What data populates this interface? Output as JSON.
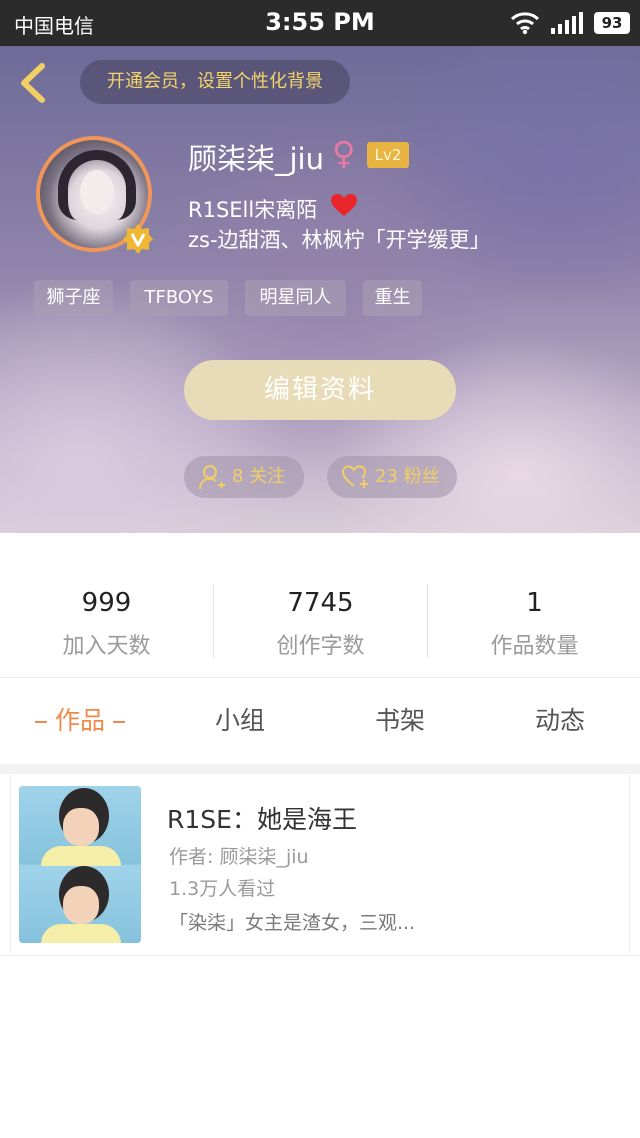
{
  "statusbar": {
    "carrier": "中国电信",
    "time": "3:55 PM",
    "battery": "93"
  },
  "header": {
    "vip_prompt": "开通会员，设置个性化背景",
    "username": "顾柒柒_jiu",
    "gender_symbol": "♀",
    "level": "Lv2",
    "bio_line1": "R1SEll宋离陌",
    "bio_line2": "zs-边甜酒、林枫柠「开学缓更」",
    "tags": [
      "狮子座",
      "TFBOYS",
      "明星同人",
      "重生"
    ],
    "edit_label": "编辑资料",
    "following_label": "8 关注",
    "followers_label": "23 粉丝"
  },
  "stats": [
    {
      "value": "999",
      "label": "加入天数"
    },
    {
      "value": "7745",
      "label": "创作字数"
    },
    {
      "value": "1",
      "label": "作品数量"
    }
  ],
  "tabs": [
    {
      "label": "作品",
      "active": true
    },
    {
      "label": "小组",
      "active": false
    },
    {
      "label": "书架",
      "active": false
    },
    {
      "label": "动态",
      "active": false
    }
  ],
  "works": [
    {
      "title": "R1SE：她是海王",
      "author": "作者: 顾柒柒_jiu",
      "views": "1.3万人看过",
      "description": "「染柒」女主是渣女，三观..."
    }
  ],
  "colors": {
    "accent": "#ef8a49",
    "gold": "#f1cf64",
    "level_badge": "#e8b542",
    "edit_button": "#e8dbb8"
  }
}
